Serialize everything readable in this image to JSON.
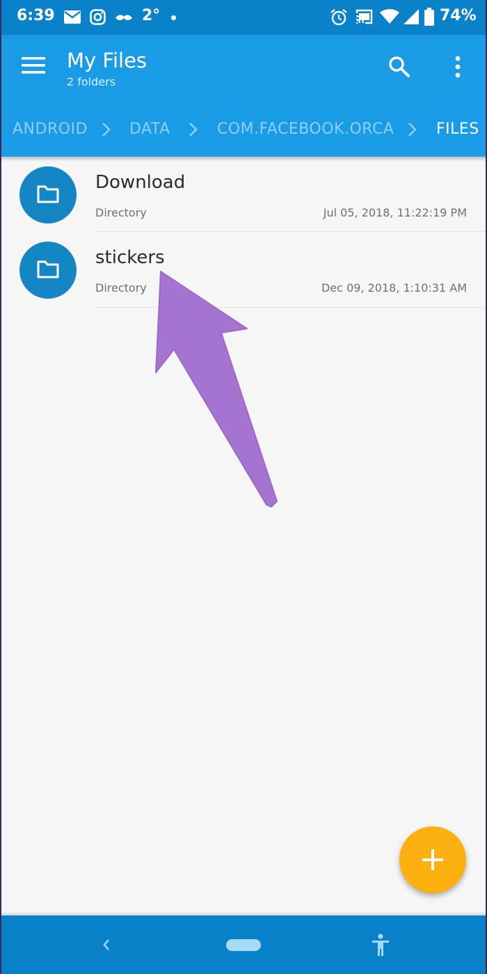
{
  "status_bar": {
    "time": "6:39",
    "temperature": "2°",
    "battery": "74%",
    "icons": [
      "mail-icon",
      "instagram-icon",
      "mustache-icon",
      "dot-icon",
      "alarm-icon",
      "cast-icon",
      "wifi-icon",
      "signal-icon",
      "battery-icon"
    ]
  },
  "app_bar": {
    "title": "My Files",
    "subtitle": "2 folders",
    "icons": [
      "menu-icon",
      "search-icon",
      "more-vert-icon"
    ]
  },
  "breadcrumb": {
    "items": [
      "ANDROID",
      "DATA",
      "COM.FACEBOOK.ORCA",
      "FILES"
    ],
    "current_index": 3
  },
  "files": [
    {
      "name": "Download",
      "type": "Directory",
      "modified": "Jul 05, 2018, 11:22:19 PM",
      "icon": "folder-icon"
    },
    {
      "name": "stickers",
      "type": "Directory",
      "modified": "Dec 09, 2018, 1:10:31 AM",
      "icon": "folder-icon"
    }
  ],
  "fab": {
    "icon": "plus-icon"
  },
  "nav_bar": {
    "icons": [
      "back-icon",
      "home-pill-icon",
      "accessibility-icon"
    ]
  },
  "colors": {
    "status_bar": "#0a82c9",
    "app_bar": "#1a9be5",
    "breadcrumb_inactive": "#8fd0fb",
    "folder_avatar": "#1486c4",
    "fab": "#fbb00f",
    "annotation_arrow": "#a574d1"
  }
}
